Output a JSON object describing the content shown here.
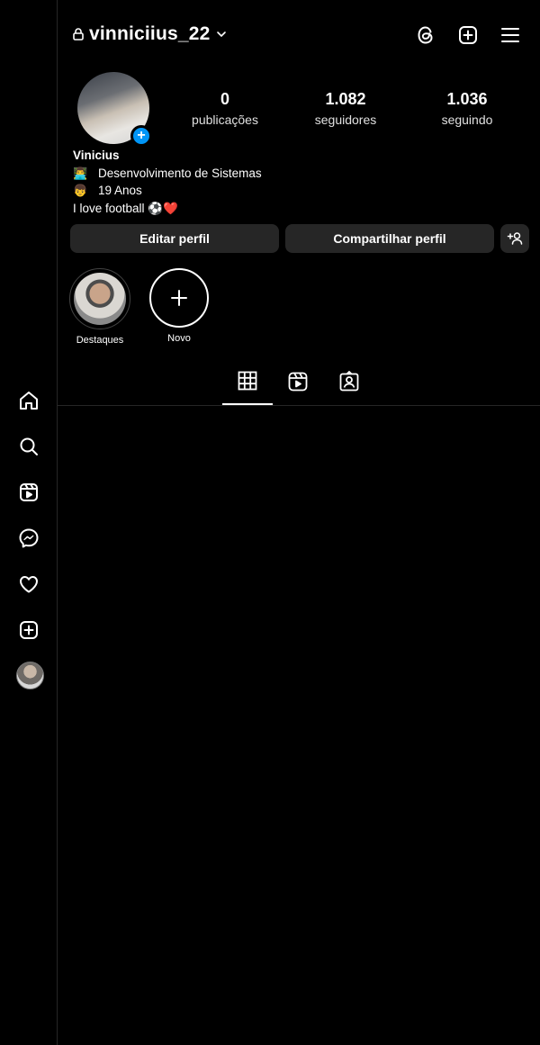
{
  "header": {
    "username": "vinniciius_22",
    "icons": [
      "lock-icon",
      "chevron-down-icon",
      "threads-icon",
      "plus-square-icon",
      "menu-icon"
    ]
  },
  "profile": {
    "stats": [
      {
        "value": "0",
        "label": "publicações"
      },
      {
        "value": "1.082",
        "label": "seguidores"
      },
      {
        "value": "1.036",
        "label": "seguindo"
      }
    ],
    "name": "Vinicius",
    "bio_lines": [
      {
        "emoji": "👨‍💻",
        "text": "Desenvolvimento de Sistemas"
      },
      {
        "emoji": "👦",
        "text": "19 Anos"
      }
    ],
    "bio_last": "I love football ⚽❤️"
  },
  "buttons": {
    "edit": "Editar perfil",
    "share": "Compartilhar perfil"
  },
  "highlights": [
    {
      "label": "Destaques"
    },
    {
      "label": "Novo"
    }
  ],
  "sidebar": {
    "icons": [
      "home-icon",
      "search-icon",
      "reels-icon",
      "messenger-icon",
      "heart-icon",
      "create-icon",
      "profile-avatar"
    ]
  },
  "tabs": [
    "grid-icon",
    "reels-tab-icon",
    "tagged-icon"
  ],
  "colors": {
    "accent": "#0095f6",
    "button_bg": "#262626",
    "background": "#000000"
  }
}
